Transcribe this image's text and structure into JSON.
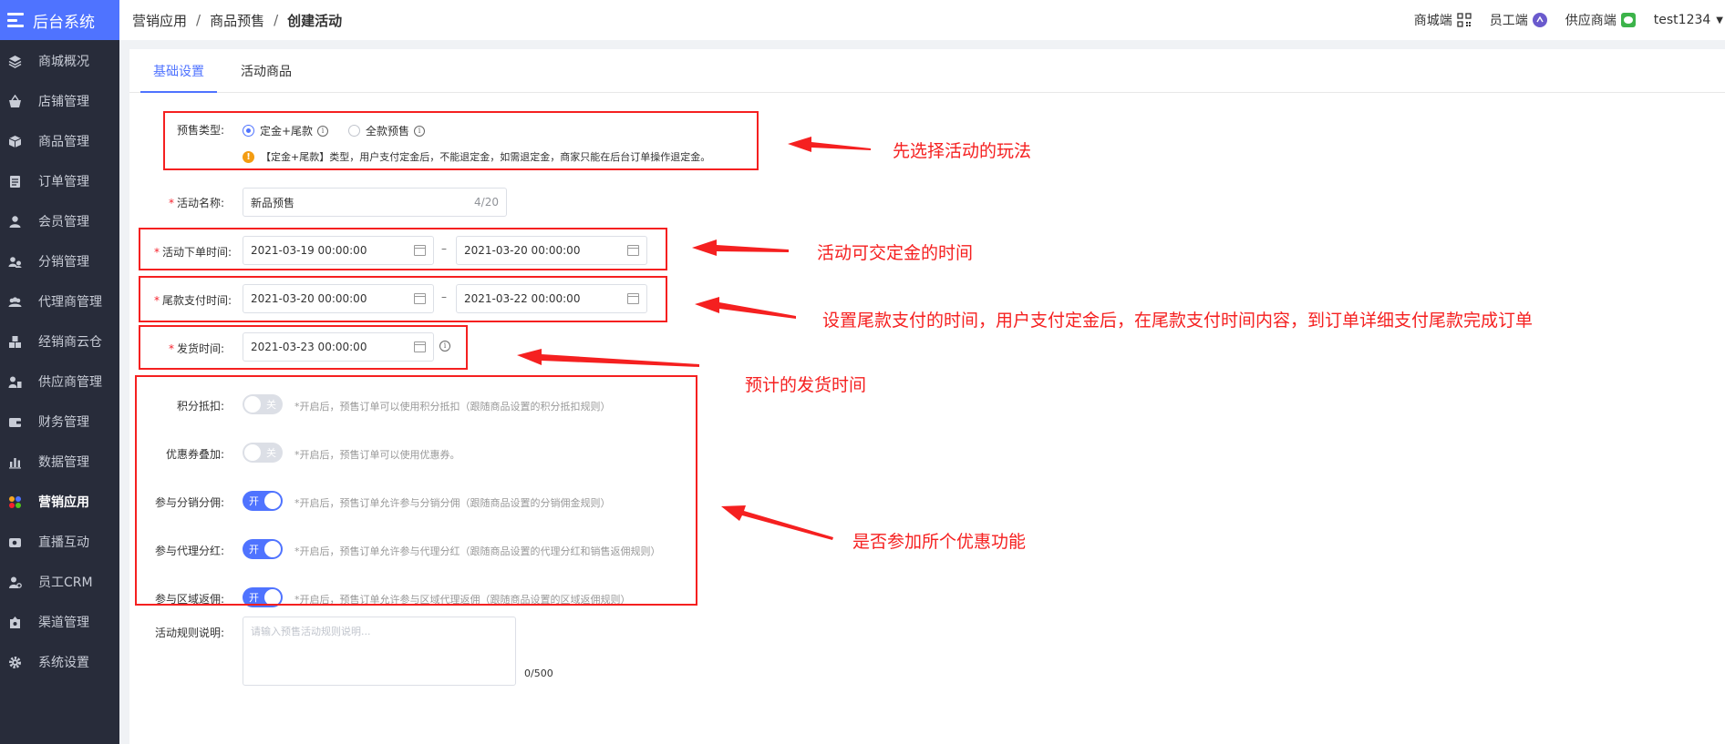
{
  "app": {
    "title": "后台系统"
  },
  "sidebar": {
    "items": [
      {
        "label": "商城概况",
        "icon": "layers-icon"
      },
      {
        "label": "店铺管理",
        "icon": "basket-icon"
      },
      {
        "label": "商品管理",
        "icon": "box-icon"
      },
      {
        "label": "订单管理",
        "icon": "document-icon"
      },
      {
        "label": "会员管理",
        "icon": "person-icon"
      },
      {
        "label": "分销管理",
        "icon": "share-users-icon"
      },
      {
        "label": "代理商管理",
        "icon": "group-icon"
      },
      {
        "label": "经销商云仓",
        "icon": "cubes-icon"
      },
      {
        "label": "供应商管理",
        "icon": "supplier-icon"
      },
      {
        "label": "财务管理",
        "icon": "wallet-icon"
      },
      {
        "label": "数据管理",
        "icon": "bar-chart-icon"
      },
      {
        "label": "营销应用",
        "icon": "apps-icon",
        "active": true
      },
      {
        "label": "直播互动",
        "icon": "video-icon"
      },
      {
        "label": "员工CRM",
        "icon": "staff-icon"
      },
      {
        "label": "渠道管理",
        "icon": "channel-icon"
      },
      {
        "label": "系统设置",
        "icon": "gear-icon"
      }
    ]
  },
  "breadcrumb": {
    "items": [
      "营销应用",
      "商品预售",
      "创建活动"
    ],
    "separator": "/"
  },
  "header": {
    "links": [
      {
        "label": "商城端",
        "icon": "qrcode-icon"
      },
      {
        "label": "员工端",
        "icon": "staff-app-icon"
      },
      {
        "label": "供应商端",
        "icon": "wechat-icon"
      }
    ],
    "user": "test1234"
  },
  "tabs": [
    {
      "label": "基础设置",
      "active": true
    },
    {
      "label": "活动商品",
      "active": false
    }
  ],
  "form": {
    "presale_type": {
      "label": "预售类型:",
      "options": [
        {
          "label": "定金+尾款",
          "checked": true
        },
        {
          "label": "全款预售",
          "checked": false
        }
      ],
      "warning": "【定金+尾款】类型，用户支付定金后，不能退定金，如需退定金，商家只能在后台订单操作退定金。",
      "warning_icon": "!"
    },
    "activity_name": {
      "label": "活动名称:",
      "value": "新品预售",
      "count": "4/20"
    },
    "order_time": {
      "label": "活动下单时间:",
      "start": "2021-03-19 00:00:00",
      "end": "2021-03-20 00:00:00"
    },
    "balance_time": {
      "label": "尾款支付时间:",
      "start": "2021-03-20 00:00:00",
      "end": "2021-03-22 00:00:00"
    },
    "ship_time": {
      "label": "发货时间:",
      "value": "2021-03-23 00:00:00"
    },
    "range_separator": "–",
    "info_glyph": "i",
    "switches": [
      {
        "label": "积分抵扣:",
        "on": false,
        "text": "关",
        "hint": "*开启后，预售订单可以使用积分抵扣（跟随商品设置的积分抵扣规则）"
      },
      {
        "label": "优惠券叠加:",
        "on": false,
        "text": "关",
        "hint": "*开启后，预售订单可以使用优惠券。"
      },
      {
        "label": "参与分销分佣:",
        "on": true,
        "text": "开",
        "hint": "*开启后，预售订单允许参与分销分佣（跟随商品设置的分销佣金规则）"
      },
      {
        "label": "参与代理分红:",
        "on": true,
        "text": "开",
        "hint": "*开启后，预售订单允许参与代理分红（跟随商品设置的代理分红和销售返佣规则）"
      },
      {
        "label": "参与区域返佣:",
        "on": true,
        "text": "开",
        "hint": "*开启后，预售订单允许参与区域代理返佣（跟随商品设置的区域返佣规则）"
      }
    ],
    "rules": {
      "label": "活动规则说明:",
      "placeholder": "请输入预售活动规则说明...",
      "count": "0/500"
    }
  },
  "annotations": [
    "先选择活动的玩法",
    "活动可交定金的时间",
    "设置尾款支付的时间，用户支付定金后，在尾款支付时间内容，到订单详细支付尾款完成订单",
    "预计的发货时间",
    "是否参加所个优惠功能"
  ],
  "colors": {
    "accent": "#4f73ff",
    "sidebar_bg": "#282c3a",
    "annotation": "#f52020"
  }
}
